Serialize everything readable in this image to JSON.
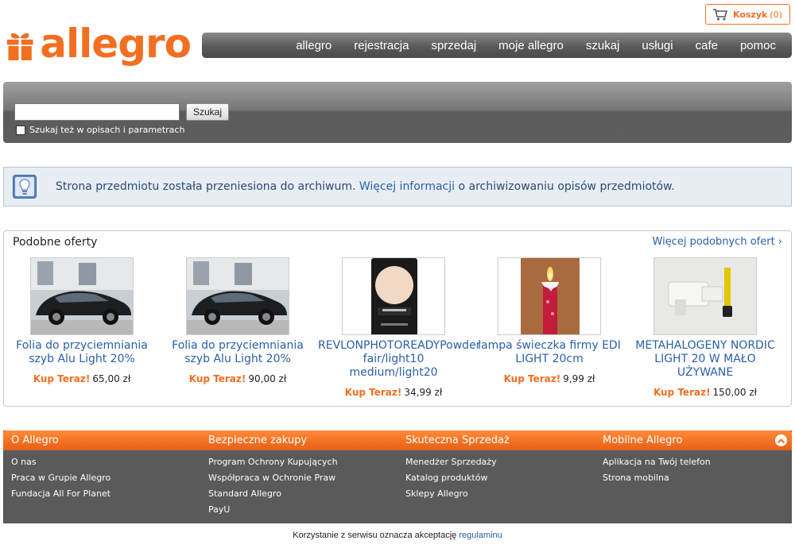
{
  "brand": {
    "logo_text": "allegro",
    "accent": "#f26f21"
  },
  "cart": {
    "label": "Koszyk",
    "count": "(0)",
    "icon": "cart-icon"
  },
  "nav": {
    "items": [
      {
        "label": "allegro"
      },
      {
        "label": "rejestracja"
      },
      {
        "label": "sprzedaj"
      },
      {
        "label": "moje allegro"
      },
      {
        "label": "szukaj"
      },
      {
        "label": "usługi"
      },
      {
        "label": "cafe"
      },
      {
        "label": "pomoc"
      }
    ]
  },
  "search": {
    "value": "",
    "button_label": "Szukaj",
    "checkbox_label": "Szukaj też w opisach i parametrach",
    "checked": false
  },
  "notice": {
    "icon": "lightbulb-icon",
    "text_before": "Strona przedmiotu została przeniesiona do archiwum.",
    "link_text": "Więcej informacji",
    "text_after": "o archiwizowaniu opisów przedmiotów."
  },
  "similar": {
    "title": "Podobne oferty",
    "more_link": "Więcej podobnych ofert ›",
    "offers": [
      {
        "title": "Folia do przyciemniania szyb Alu Light 20%",
        "buy_label": "Kup Teraz!",
        "price": "65,00 zł",
        "thumb": "car-photo"
      },
      {
        "title": "Folia do przyciemniania szyb Alu Light 20%",
        "buy_label": "Kup Teraz!",
        "price": "90,00 zł",
        "thumb": "car-photo"
      },
      {
        "title": "REVLONPHOTOREADYPowder fair/light10 medium/light20",
        "buy_label": "Kup Teraz!",
        "price": "34,99 zł",
        "thumb": "powder-photo"
      },
      {
        "title": "lampa świeczka firmy EDI LIGHT 20cm",
        "buy_label": "Kup Teraz!",
        "price": "9,99 zł",
        "thumb": "candle-photo"
      },
      {
        "title": "METAHALOGENY NORDIC LIGHT 20 W MAŁO UŻYWANE",
        "buy_label": "Kup Teraz!",
        "price": "150,00 zł",
        "thumb": "lamp-photo"
      }
    ]
  },
  "footer": {
    "columns": [
      {
        "title": "O Allegro",
        "links": [
          "O nas",
          "Praca w Grupie Allegro",
          "Fundacja All For Planet"
        ]
      },
      {
        "title": "Bezpieczne zakupy",
        "links": [
          "Program Ochrony Kupujących",
          "Współpraca w Ochronie Praw",
          "Standard Allegro",
          "PayU"
        ]
      },
      {
        "title": "Skuteczna Sprzedaż",
        "links": [
          "Menedżer Sprzedaży",
          "Katalog produktów",
          "Sklepy Allegro"
        ]
      },
      {
        "title": "Mobilne Allegro",
        "links": [
          "Aplikacja na Twój telefon",
          "Strona mobilna"
        ]
      }
    ]
  },
  "legal": {
    "text": "Korzystanie z serwisu oznacza akceptację",
    "link_text": "regulaminu"
  }
}
